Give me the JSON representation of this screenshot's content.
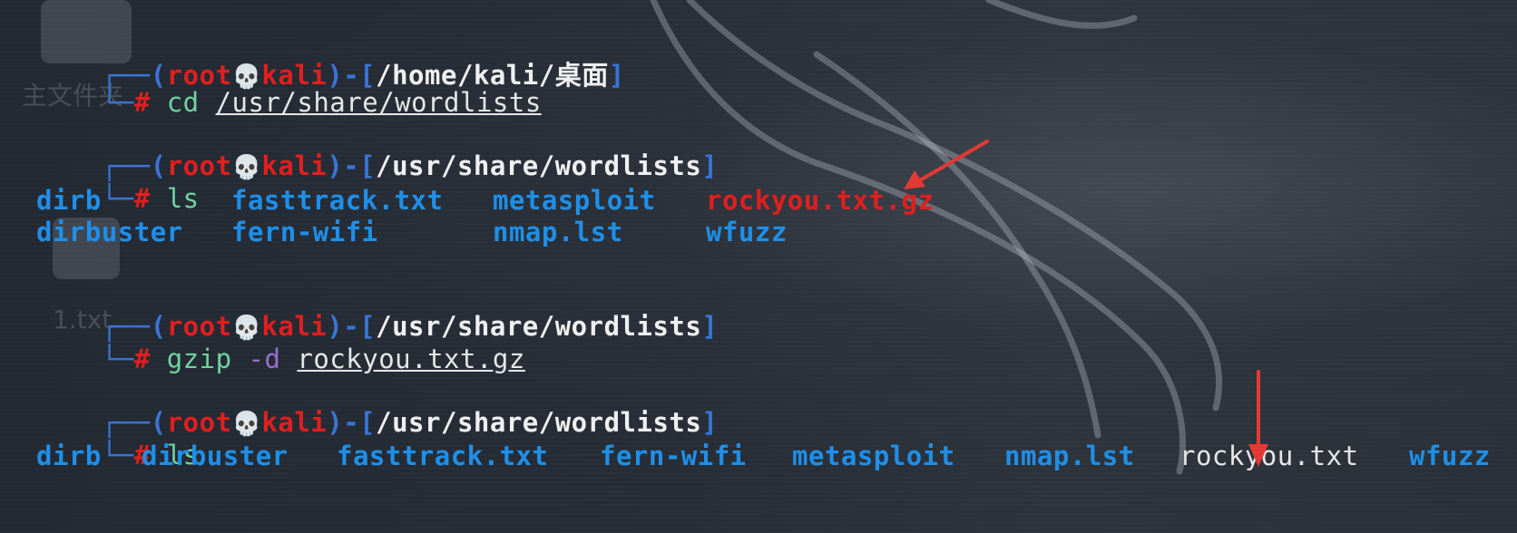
{
  "desktop": {
    "folder_label": "主文件夹",
    "file_label": "1.txt"
  },
  "prompt": {
    "user": "root",
    "skull": "💀",
    "host": "kali"
  },
  "blocks": [
    {
      "cwd": "/home/kali/桌面",
      "command": "cd",
      "args": "/usr/share/wordlists"
    },
    {
      "cwd": "/usr/share/wordlists",
      "command": "ls",
      "output_rows": [
        [
          "dirb",
          "fasttrack.txt",
          "metasploit",
          "rockyou.txt.gz"
        ],
        [
          "dirbuster",
          "fern-wifi",
          "nmap.lst",
          "wfuzz"
        ]
      ]
    },
    {
      "cwd": "/usr/share/wordlists",
      "command": "gzip",
      "option": "-d",
      "args": "rockyou.txt.gz"
    },
    {
      "cwd": "/usr/share/wordlists",
      "command": "ls",
      "output": [
        "dirb",
        "dirbuster",
        "fasttrack.txt",
        "fern-wifi",
        "metasploit",
        "nmap.lst",
        "rockyou.txt",
        "wfuzz"
      ]
    }
  ],
  "colors": {
    "frame": "#3a74d6",
    "user_host": "#e01f1f",
    "directory": "#1f8fe8",
    "command": "#6fd3a0",
    "option": "#9a6fd1",
    "arrow": "#e53935"
  }
}
